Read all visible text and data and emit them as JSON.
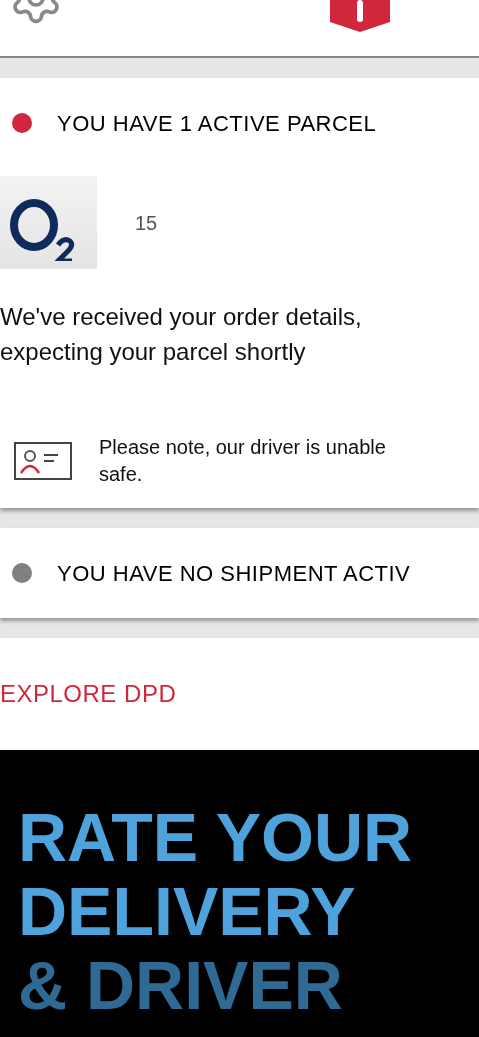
{
  "sections": [
    {
      "kind": "parcel",
      "color": "#d0273c",
      "title": "YOU HAVE 1 ACTIVE PARCEL",
      "tracking_number": "15",
      "message_lines": [
        "We've received your order details,",
        "expecting your parcel shortly"
      ],
      "note_lines": [
        "Please note, our driver is unable",
        "safe."
      ]
    },
    {
      "kind": "status",
      "color": "#808083",
      "title": "YOU HAVE NO SHIPMENT ACTIV"
    }
  ],
  "explore_link": "EXPLORE DPD",
  "banner_lines": [
    "RATE YOUR",
    "DELIVERY",
    "& DRIVER"
  ]
}
